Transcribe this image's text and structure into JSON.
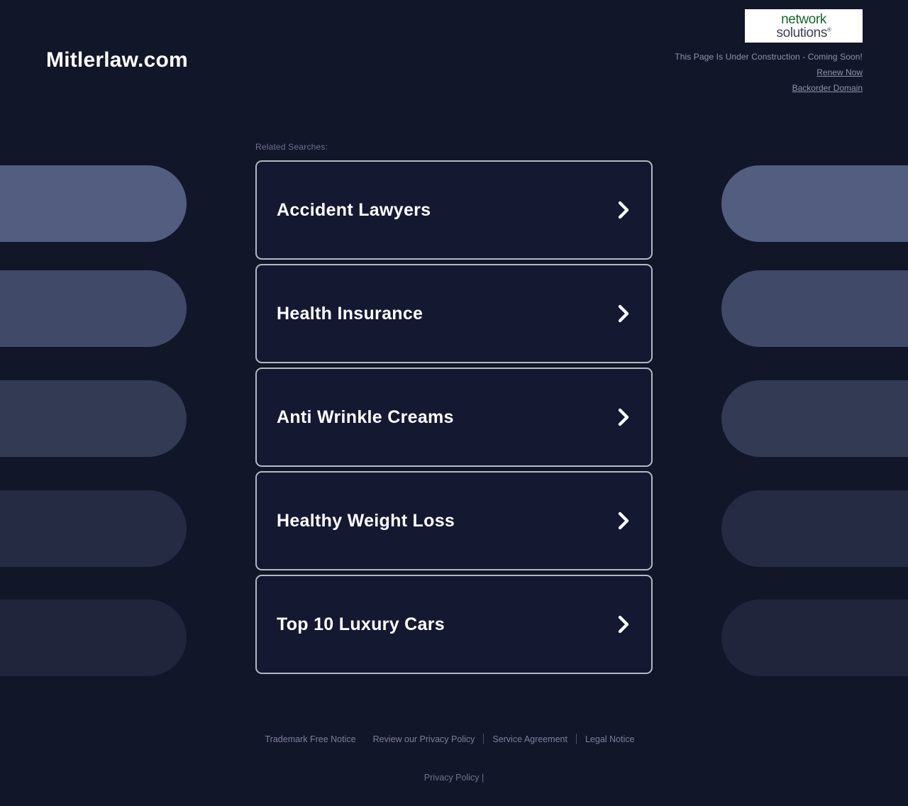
{
  "page": {
    "background_color": "#121629",
    "accent_border_color": "#b4b8c2"
  },
  "header": {
    "brand": "Mitlerlaw.com",
    "logo": {
      "name": "network-solutions-logo",
      "line1": "network",
      "line2": "solutions",
      "trademark": "®",
      "line1_color": "#18682f",
      "line2_color": "#3c4251"
    },
    "construction_notice": "This Page Is Under Construction - Coming Soon!",
    "renew_link": "Renew Now",
    "backorder_link": "Backorder Domain"
  },
  "main": {
    "related_label": "Related Searches:",
    "cards": [
      {
        "title": "Accident Lawyers",
        "icon": "chevron-right-icon"
      },
      {
        "title": "Health Insurance",
        "icon": "chevron-right-icon"
      },
      {
        "title": "Anti Wrinkle Creams",
        "icon": "chevron-right-icon"
      },
      {
        "title": "Healthy Weight Loss",
        "icon": "chevron-right-icon"
      },
      {
        "title": "Top 10 Luxury Cars",
        "icon": "chevron-right-icon"
      }
    ]
  },
  "footer": {
    "links": [
      "Trademark Free Notice",
      "Review our Privacy Policy",
      "Service Agreement",
      "Legal Notice"
    ],
    "bottom_link": "Privacy Policy",
    "bottom_separator": "|"
  }
}
